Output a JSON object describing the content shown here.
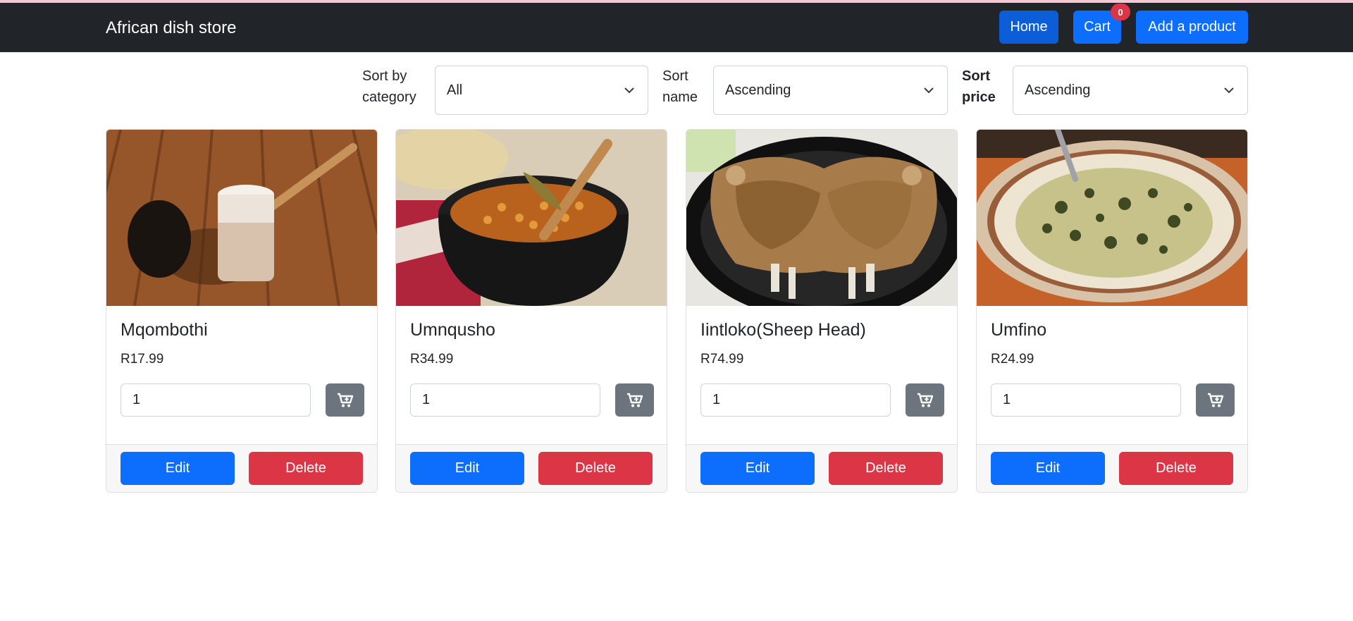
{
  "navbar": {
    "brand": "African dish store",
    "home_label": "Home",
    "cart_label": "Cart",
    "cart_count": "0",
    "add_label": "Add a product"
  },
  "sort": {
    "category_label_line1": "Sort by",
    "category_label_line2": "category",
    "category_value": "All",
    "name_label_line1": "Sort",
    "name_label_line2": "name",
    "name_value": "Ascending",
    "price_label_line1": "Sort",
    "price_label_line2": "price",
    "price_value": "Ascending"
  },
  "products": [
    {
      "name": "Mqombothi",
      "price": "R17.99",
      "qty": "1",
      "edit": "Edit",
      "delete": "Delete"
    },
    {
      "name": "Umnqusho",
      "price": "R34.99",
      "qty": "1",
      "edit": "Edit",
      "delete": "Delete"
    },
    {
      "name": "Iintloko(Sheep Head)",
      "price": "R74.99",
      "qty": "1",
      "edit": "Edit",
      "delete": "Delete"
    },
    {
      "name": "Umfino",
      "price": "R24.99",
      "qty": "1",
      "edit": "Edit",
      "delete": "Delete"
    }
  ],
  "icons": {
    "cart_button": "cart-plus-icon",
    "select_arrow": "chevron-down-icon"
  },
  "colors": {
    "navbar": "#212529",
    "primary": "#0d6efd",
    "danger": "#dc3545",
    "secondary": "#6c757d"
  }
}
